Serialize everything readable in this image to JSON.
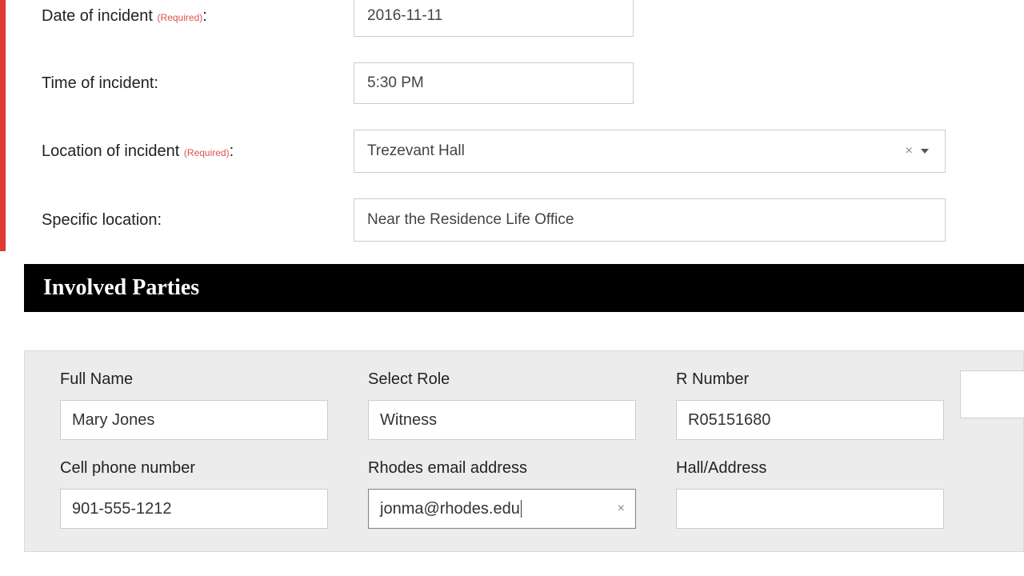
{
  "incident": {
    "date_label": "Date of incident",
    "date_value": "2016-11-11",
    "time_label": "Time of incident:",
    "time_value": "5:30 PM",
    "location_label": "Location of incident",
    "location_value": "Trezevant Hall",
    "specific_label": "Specific location:",
    "specific_value": "Near the Residence Life Office",
    "required_text": "(Required)"
  },
  "section": {
    "involved_title": "Involved Parties"
  },
  "party": {
    "full_name_label": "Full Name",
    "full_name_value": "Mary Jones",
    "role_label": "Select Role",
    "role_value": "Witness",
    "rnum_label": "R Number",
    "rnum_value": "R05151680",
    "cell_label": "Cell phone number",
    "cell_value": "901-555-1212",
    "email_label": "Rhodes email address",
    "email_value": "jonma@rhodes.edu",
    "hall_label": "Hall/Address",
    "hall_value": ""
  },
  "icons": {
    "clear": "×"
  }
}
